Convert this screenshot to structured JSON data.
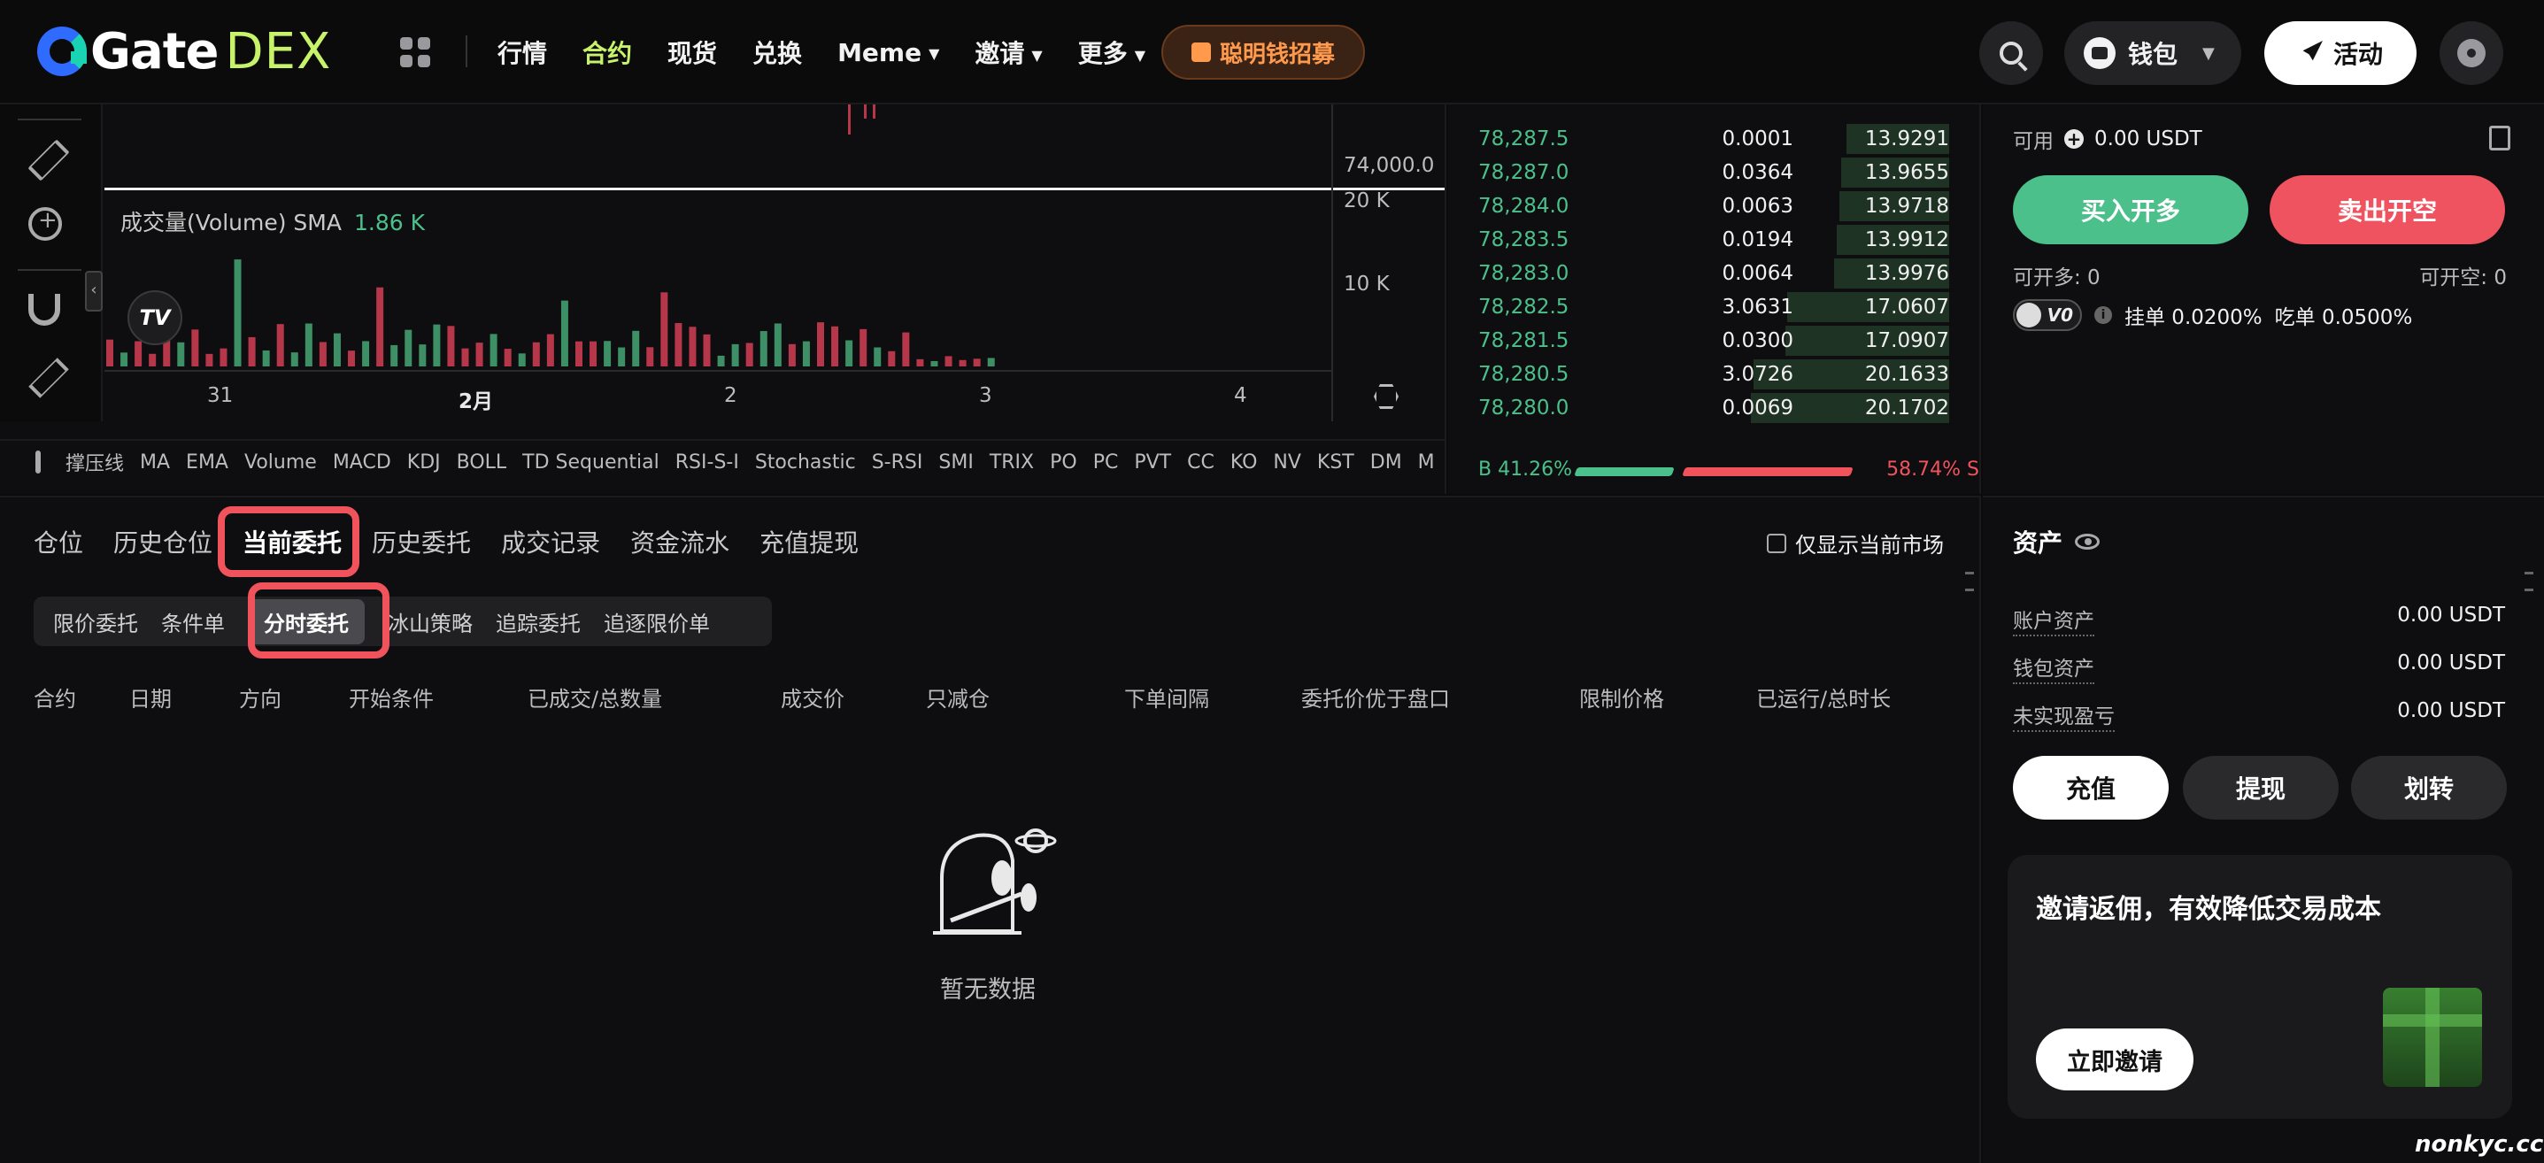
{
  "brand": {
    "name_part1": "Gate",
    "name_part2": "DEX",
    "accent": "#c8f26a"
  },
  "nav": {
    "items": [
      {
        "label": "行情",
        "active": false,
        "dropdown": false
      },
      {
        "label": "合约",
        "active": true,
        "dropdown": false
      },
      {
        "label": "现货",
        "active": false,
        "dropdown": false
      },
      {
        "label": "兑换",
        "active": false,
        "dropdown": false
      },
      {
        "label": "Meme",
        "active": false,
        "dropdown": true
      },
      {
        "label": "邀请",
        "active": false,
        "dropdown": true
      },
      {
        "label": "更多",
        "active": false,
        "dropdown": true
      }
    ],
    "promo_label": "聪明钱招募",
    "wallet_label": "钱包",
    "activity_label": "活动"
  },
  "chart": {
    "price_level": "74,000.0",
    "volume_axis_labels": [
      "20 K",
      "10 K"
    ],
    "volume_legend_label": "成交量(Volume) SMA",
    "volume_legend_value": "1.86 K",
    "x_ticks": [
      "31",
      "2月",
      "2",
      "3",
      "4"
    ],
    "indicators": [
      "撑压线",
      "MA",
      "EMA",
      "Volume",
      "MACD",
      "KDJ",
      "BOLL",
      "TD Sequential",
      "RSI-S-I",
      "Stochastic",
      "S-RSI",
      "SMI",
      "TRIX",
      "PO",
      "PC",
      "PVT",
      "CC",
      "KO",
      "NV",
      "KST",
      "DM",
      "M"
    ],
    "colors": {
      "up": "#3d8f65",
      "down": "#b7374a"
    }
  },
  "orderbook": {
    "rows": [
      {
        "price": "78,287.5",
        "qty": "0.0001",
        "total": "13.9291",
        "depth": 0.42
      },
      {
        "price": "78,287.0",
        "qty": "0.0364",
        "total": "13.9655",
        "depth": 0.44
      },
      {
        "price": "78,284.0",
        "qty": "0.0063",
        "total": "13.9718",
        "depth": 0.45
      },
      {
        "price": "78,283.5",
        "qty": "0.0194",
        "total": "13.9912",
        "depth": 0.46
      },
      {
        "price": "78,283.0",
        "qty": "0.0064",
        "total": "13.9976",
        "depth": 0.47
      },
      {
        "price": "78,282.5",
        "qty": "3.0631",
        "total": "17.0607",
        "depth": 0.66
      },
      {
        "price": "78,281.5",
        "qty": "0.0300",
        "total": "17.0907",
        "depth": 0.67
      },
      {
        "price": "78,280.5",
        "qty": "3.0726",
        "total": "20.1633",
        "depth": 0.8
      },
      {
        "price": "78,280.0",
        "qty": "0.0069",
        "total": "20.1702",
        "depth": 0.81
      }
    ],
    "buy_ratio": "B 41.26%",
    "sell_ratio": "58.74% S"
  },
  "trade": {
    "available_label": "可用",
    "available_value": "0.00 USDT",
    "buy_label": "买入开多",
    "sell_label": "卖出开空",
    "can_long": "可开多: 0",
    "can_short": "可开空: 0",
    "vip_level": "V0",
    "maker_fee": "挂单 0.0200%",
    "taker_fee": "吃单 0.0500%"
  },
  "orders": {
    "tabs": [
      {
        "label": "仓位",
        "active": false
      },
      {
        "label": "历史仓位",
        "active": false
      },
      {
        "label": "当前委托",
        "active": true
      },
      {
        "label": "历史委托",
        "active": false
      },
      {
        "label": "成交记录",
        "active": false
      },
      {
        "label": "资金流水",
        "active": false
      },
      {
        "label": "充值提现",
        "active": false
      }
    ],
    "only_current_label": "仅显示当前市场",
    "subtabs": [
      {
        "label": "限价委托",
        "active": false
      },
      {
        "label": "条件单",
        "active": false
      },
      {
        "label": "分时委托",
        "active": true
      },
      {
        "label": "冰山策略",
        "active": false
      },
      {
        "label": "追踪委托",
        "active": false
      },
      {
        "label": "追逐限价单",
        "active": false
      }
    ],
    "columns": [
      "合约",
      "日期",
      "方向",
      "开始条件",
      "已成交/总数量",
      "成交价",
      "只减仓",
      "下单间隔",
      "委托价优于盘口",
      "限制价格",
      "已运行/总时长"
    ],
    "empty_text": "暂无数据"
  },
  "assets": {
    "title": "资产",
    "rows": [
      {
        "label": "账户资产",
        "value": "0.00 USDT"
      },
      {
        "label": "钱包资产",
        "value": "0.00 USDT"
      },
      {
        "label": "未实现盈亏",
        "value": "0.00 USDT"
      }
    ],
    "deposit_label": "充值",
    "withdraw_label": "提现",
    "transfer_label": "划转",
    "invite_title": "邀请返佣，有效降低交易成本",
    "invite_button": "立即邀请"
  },
  "watermark": "nonkyc.cc"
}
